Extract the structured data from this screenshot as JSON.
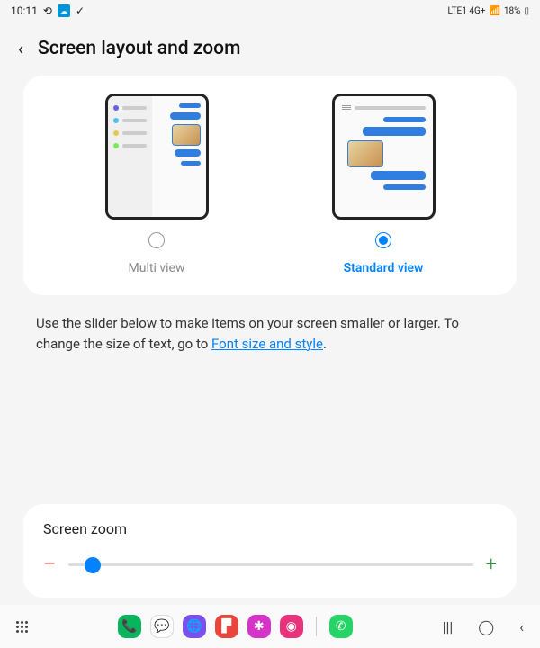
{
  "status": {
    "time": "10:11",
    "network": "LTE1 4G+",
    "signal": "▫▪▪▮",
    "battery": "18%"
  },
  "header": {
    "title": "Screen layout and zoom"
  },
  "options": {
    "multi": {
      "label": "Multi view",
      "selected": false
    },
    "standard": {
      "label": "Standard view",
      "selected": true
    }
  },
  "description": {
    "line1": "Use the slider below to make items on your screen smaller or larger. To change the size of text, go to ",
    "link": "Font size and style",
    "tail": "."
  },
  "zoom": {
    "title": "Screen zoom",
    "min_symbol": "–",
    "max_symbol": "+",
    "value_percent": 6
  },
  "nav": {
    "apps": [
      "phone",
      "chat",
      "browser",
      "flip",
      "gallery",
      "camera",
      "whatsapp"
    ]
  }
}
